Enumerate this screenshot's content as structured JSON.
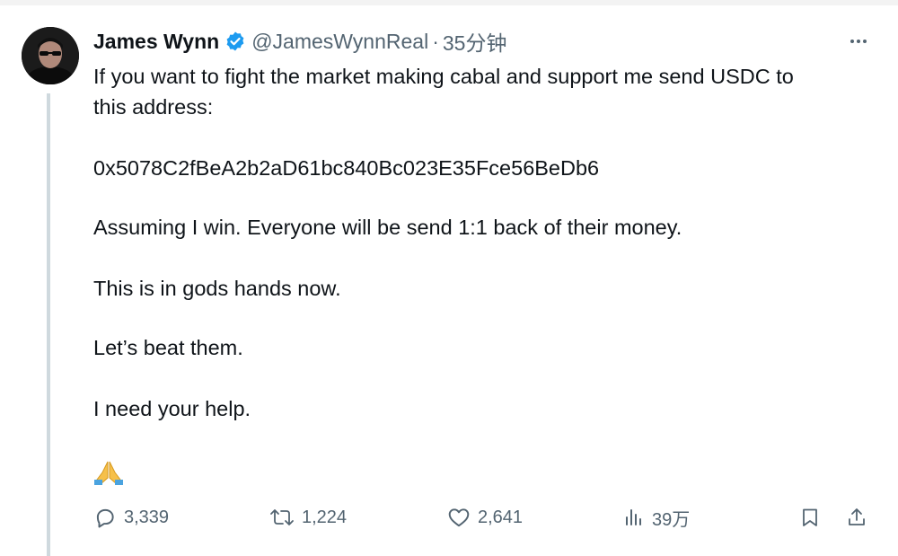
{
  "tweet": {
    "author_name": "James Wynn",
    "handle": "@JamesWynnReal",
    "separator": "·",
    "time": "35分钟",
    "lines": [
      "If you want to fight the market making cabal and support me send USDC to",
      "this address:",
      "0x5078C2fBeA2b2aD61bc840Bc023E35Fce56BeDb6",
      "Assuming I win. Everyone will be send 1:1 back of their money.",
      "This is in gods hands now.",
      "Let’s beat them.",
      "I need your help."
    ],
    "emoji": "folded-hands"
  },
  "actions": {
    "replies": "3,339",
    "reposts": "1,224",
    "likes": "2,641",
    "views": "39万"
  },
  "colors": {
    "text": "#0f1419",
    "muted": "#536471",
    "verified": "#1d9bf0",
    "thread_line": "#cfd9de"
  }
}
